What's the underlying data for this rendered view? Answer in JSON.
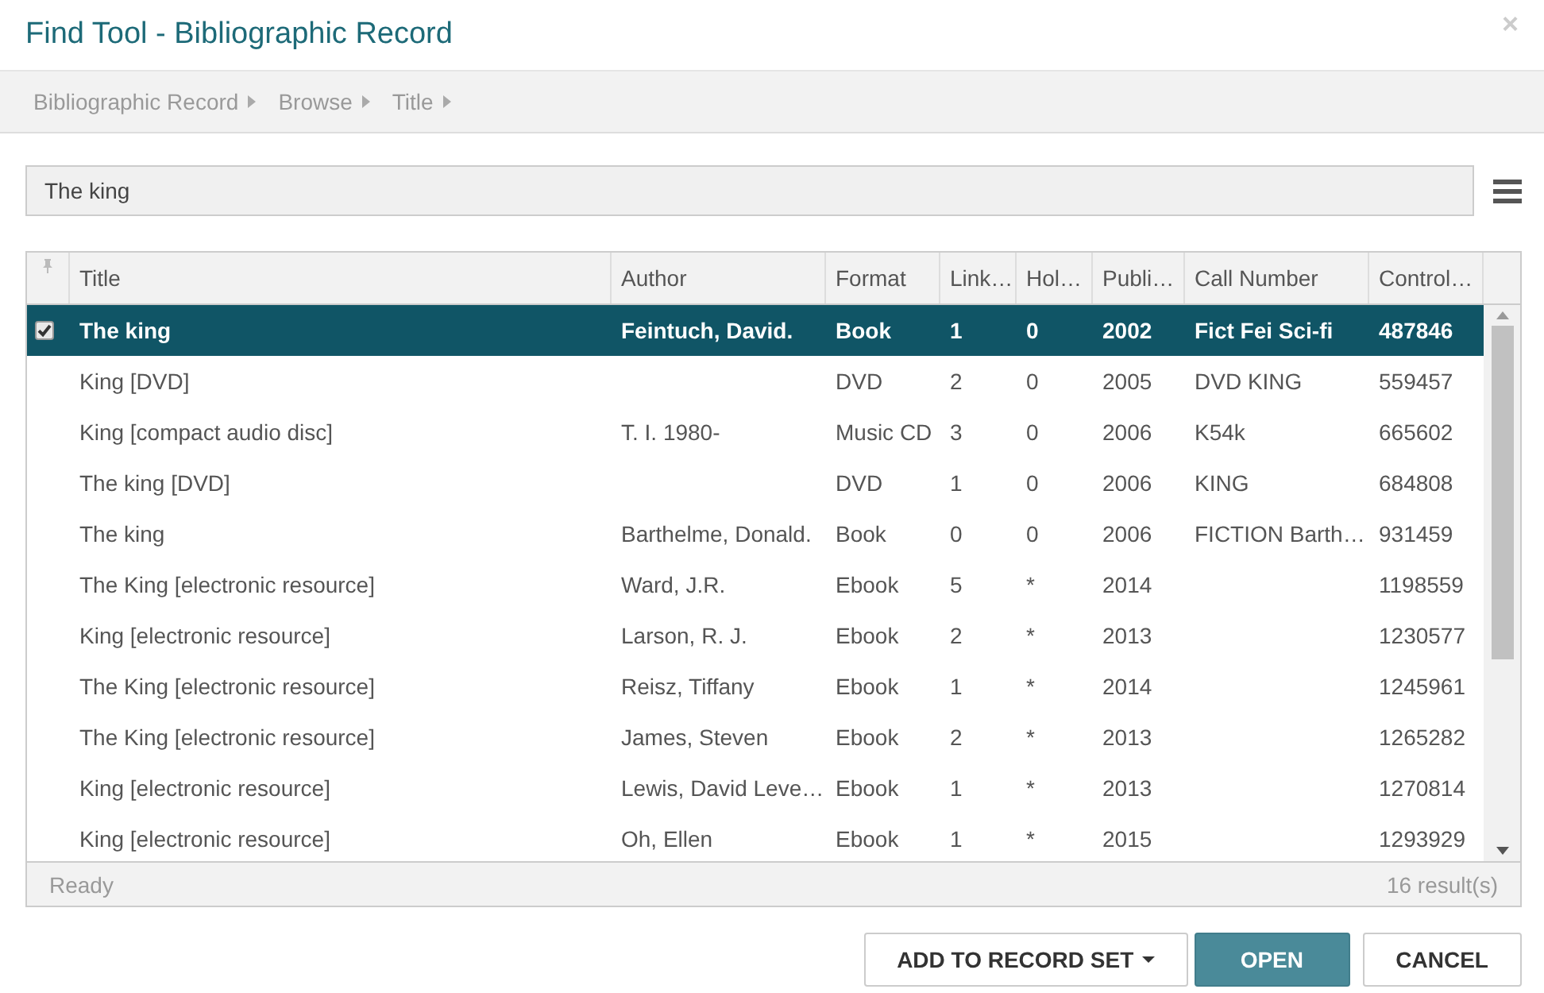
{
  "window": {
    "title": "Find Tool - Bibliographic Record",
    "close": "×"
  },
  "breadcrumbs": [
    "Bibliographic Record",
    "Browse",
    "Title"
  ],
  "search": {
    "value": "The king"
  },
  "table": {
    "columns": [
      "Title",
      "Author",
      "Format",
      "Link…",
      "Hol…",
      "Publi…",
      "Call Number",
      "Control…"
    ],
    "rows": [
      {
        "selected": true,
        "cells": [
          "The king",
          "Feintuch, David.",
          "Book",
          "1",
          "0",
          "2002",
          "Fict Fei Sci-fi",
          "487846"
        ]
      },
      {
        "selected": false,
        "cells": [
          "King [DVD]",
          "",
          "DVD",
          "2",
          "0",
          "2005",
          "DVD KING",
          "559457"
        ]
      },
      {
        "selected": false,
        "cells": [
          "King [compact audio disc]",
          "T. I. 1980-",
          "Music CD",
          "3",
          "0",
          "2006",
          "K54k",
          "665602"
        ]
      },
      {
        "selected": false,
        "cells": [
          "The king [DVD]",
          "",
          "DVD",
          "1",
          "0",
          "2006",
          "KING",
          "684808"
        ]
      },
      {
        "selected": false,
        "cells": [
          "The king",
          "Barthelme, Donald.",
          "Book",
          "0",
          "0",
          "2006",
          "FICTION Barth…",
          "931459"
        ]
      },
      {
        "selected": false,
        "cells": [
          "The King [electronic resource]",
          "Ward, J.R.",
          "Ebook",
          "5",
          "*",
          "2014",
          "",
          "1198559"
        ]
      },
      {
        "selected": false,
        "cells": [
          "King [electronic resource]",
          "Larson, R. J.",
          "Ebook",
          "2",
          "*",
          "2013",
          "",
          "1230577"
        ]
      },
      {
        "selected": false,
        "cells": [
          "The King [electronic resource]",
          "Reisz, Tiffany",
          "Ebook",
          "1",
          "*",
          "2014",
          "",
          "1245961"
        ]
      },
      {
        "selected": false,
        "cells": [
          "The King [electronic resource]",
          "James, Steven",
          "Ebook",
          "2",
          "*",
          "2013",
          "",
          "1265282"
        ]
      },
      {
        "selected": false,
        "cells": [
          "King [electronic resource]",
          "Lewis, David Leve…",
          "Ebook",
          "1",
          "*",
          "2013",
          "",
          "1270814"
        ]
      },
      {
        "selected": false,
        "cells": [
          "King [electronic resource]",
          "Oh, Ellen",
          "Ebook",
          "1",
          "*",
          "2015",
          "",
          "1293929"
        ]
      }
    ]
  },
  "status_bar": {
    "status": "Ready",
    "count": "16 result(s)"
  },
  "buttons": [
    {
      "label": "ADD TO RECORD SET",
      "kind": "dropdown"
    },
    {
      "label": "OPEN",
      "kind": "primary"
    },
    {
      "label": "CANCEL",
      "kind": "default"
    }
  ]
}
